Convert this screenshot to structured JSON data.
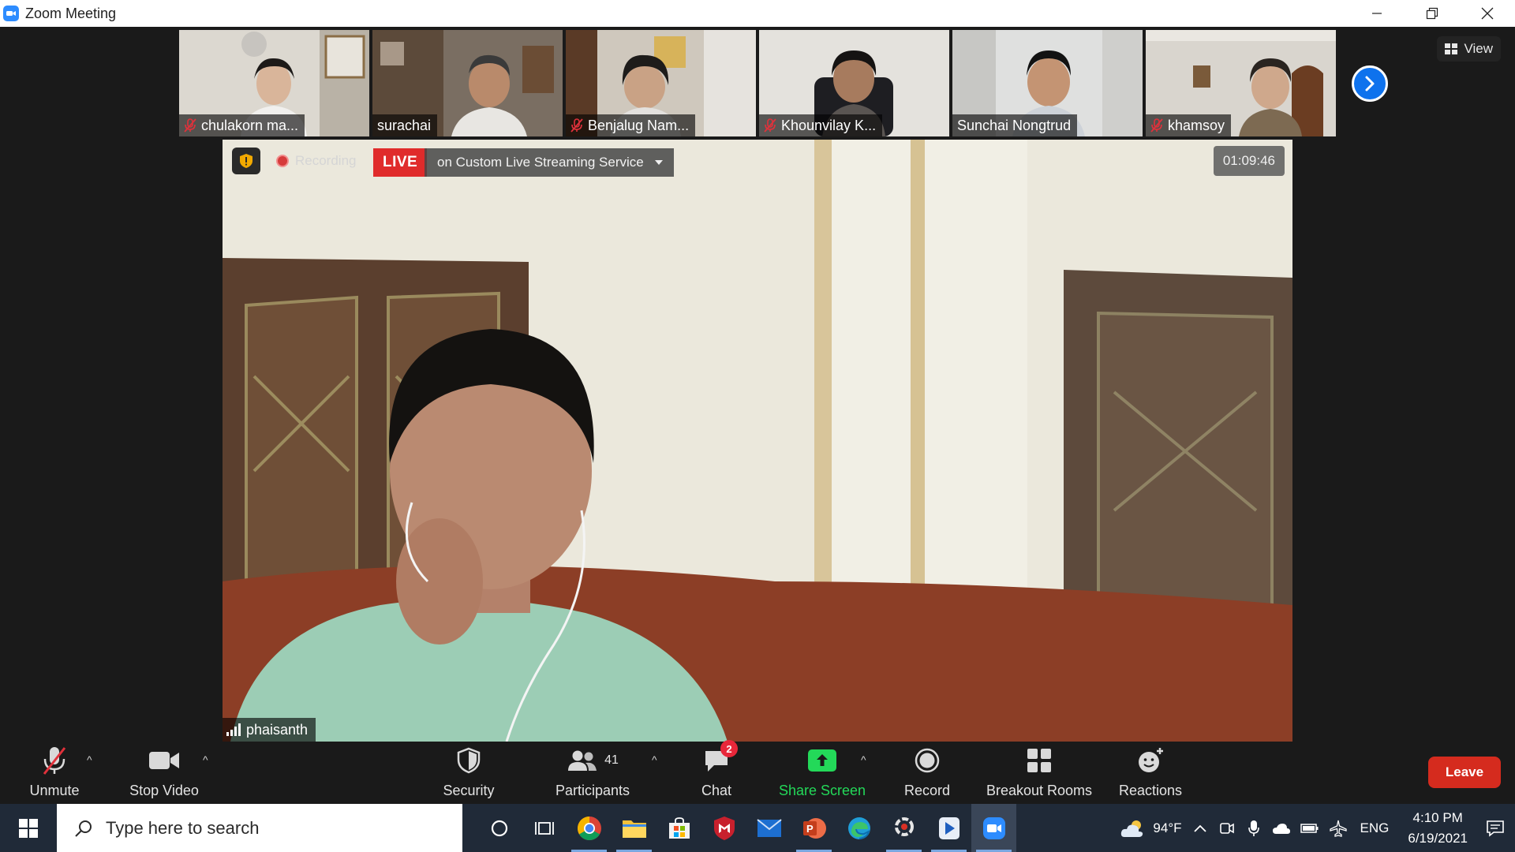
{
  "window": {
    "title": "Zoom Meeting"
  },
  "view_button": {
    "label": "View"
  },
  "thumbnails": [
    {
      "name": "chulakorn ma...",
      "muted": true
    },
    {
      "name": "surachai",
      "muted": false
    },
    {
      "name": "Benjalug Nam...",
      "muted": true
    },
    {
      "name": "Khounvilay K...",
      "muted": true
    },
    {
      "name": "Sunchai Nongtrud",
      "muted": false
    },
    {
      "name": "khamsoy",
      "muted": true
    }
  ],
  "main_video": {
    "recording_label": "Recording",
    "live_label": "LIVE",
    "stream_label": "on Custom Live Streaming Service",
    "timer": "01:09:46",
    "speaker_name": "phaisanth"
  },
  "toolbar": {
    "unmute": "Unmute",
    "stop_video": "Stop Video",
    "security": "Security",
    "participants": "Participants",
    "participants_count": "41",
    "chat": "Chat",
    "chat_badge": "2",
    "share_screen": "Share Screen",
    "record": "Record",
    "breakout_rooms": "Breakout Rooms",
    "reactions": "Reactions",
    "leave": "Leave"
  },
  "taskbar": {
    "search_placeholder": "Type here to search",
    "weather": "94°F",
    "language": "ENG",
    "time": "4:10 PM",
    "date": "6/19/2021"
  },
  "colors": {
    "zoom_blue": "#2d8cff",
    "live_red": "#e02b2b",
    "share_green": "#23d959",
    "leave_red": "#d52b1e",
    "taskbar": "#202a38"
  }
}
